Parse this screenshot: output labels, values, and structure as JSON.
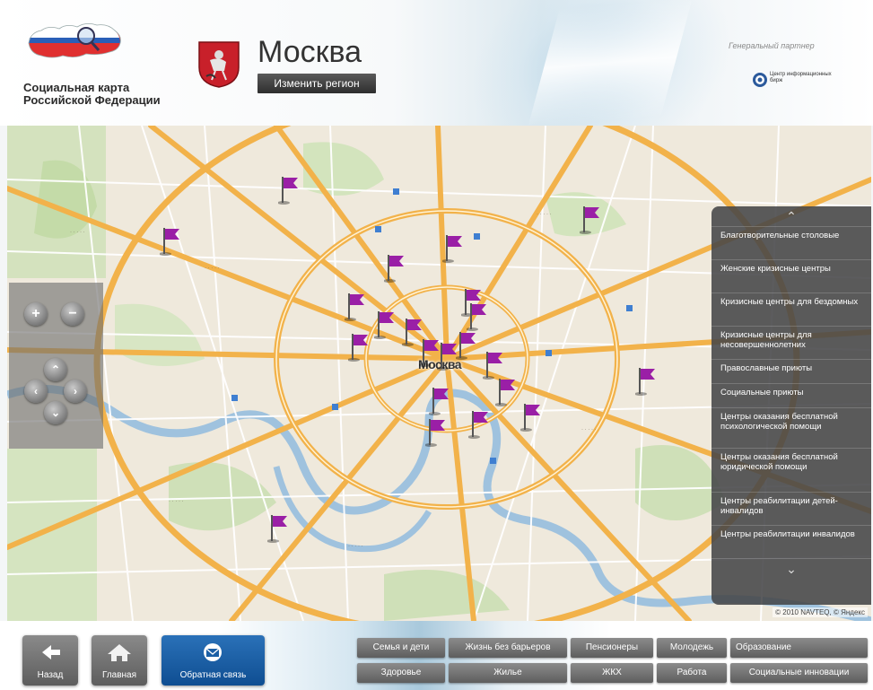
{
  "header": {
    "logo_title": "Социальная карта Российской Федерации",
    "city": "Москва",
    "change_region": "Изменить регион",
    "partner_caption": "Генеральный партнер",
    "partner_name": "Центр информационных бирж"
  },
  "map": {
    "center_label": "Москва",
    "copyright": "© 2010 NAVTEQ, © Яндекс",
    "flag_count": 22,
    "controls": {
      "zoom_in": "+",
      "zoom_out": "−"
    }
  },
  "categories": {
    "up_arrow": "⌃",
    "down_arrow": "⌄",
    "items": [
      "Благотворительные столовые",
      "Женские кризисные центры",
      "Кризисные центры для бездомных",
      "Кризисные центры для несовершеннолетних",
      "Православные приюты",
      "Социальные приюты",
      "Центры оказания бесплатной психологической помощи",
      "Центры оказания бесплатной юридической помощи",
      "Центры реабилитации детей-инвалидов",
      "Центры реабилитации инвалидов"
    ]
  },
  "footer": {
    "back": "Назад",
    "home": "Главная",
    "feedback": "Обратная связь",
    "tags_row1": [
      "Семья и дети",
      "Жизнь без барьеров",
      "Пенсионеры",
      "Молодежь",
      "Образование"
    ],
    "tags_row2": [
      "Здоровье",
      "Жилье",
      "ЖКХ",
      "Работа",
      "Социальные инновации"
    ]
  },
  "colors": {
    "flag": "#9a1fa6",
    "road_major": "#f3b54a",
    "road_minor": "#ffffff",
    "park": "#cfe1b4",
    "water": "#9fc3e0",
    "feedback_button": "#1b5fa5"
  }
}
